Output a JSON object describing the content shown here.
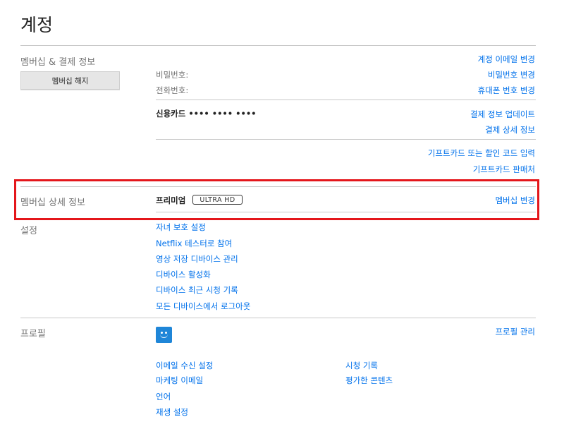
{
  "page": {
    "title": "계정"
  },
  "membership": {
    "section_label": "멤버십 & 결제 정보",
    "cancel_button": "멤버십 해지",
    "password_label": "비밀번호:",
    "phone_label": "전화번호:",
    "card_label": "신용카드 •••• •••• ••••",
    "links": {
      "change_email": "계정 이메일 변경",
      "change_password": "비밀번호 변경",
      "change_phone": "휴대폰 번호 변경",
      "update_payment": "결제 정보 업데이트",
      "billing_details": "결제 상세 정보",
      "redeem_gift": "기프트카드 또는 할인 코드 입력",
      "gift_retailers": "기프트카드 판매처"
    }
  },
  "plan": {
    "section_label": "멤버십 상세 정보",
    "plan_name": "프리미엄",
    "plan_badge": "ULTRA HD",
    "change_plan": "멤버십 변경"
  },
  "settings": {
    "section_label": "설정",
    "links": [
      "자녀 보호 설정",
      "Netflix 테스터로 참여",
      "영상 저장 디바이스 관리",
      "디바이스 활성화",
      "디바이스 최근 시청 기록",
      "모든 디바이스에서 로그아웃"
    ]
  },
  "profile": {
    "section_label": "프로필",
    "manage_profiles": "프로필 관리",
    "left_links": [
      "이메일 수신 설정",
      "마케팅 이메일",
      "언어",
      "재생 설정"
    ],
    "right_links": [
      "시청 기록",
      "평가한 콘텐츠"
    ]
  },
  "colors": {
    "link": "#0071eb",
    "highlight": "#e4161b",
    "avatar": "#1f86d8"
  }
}
